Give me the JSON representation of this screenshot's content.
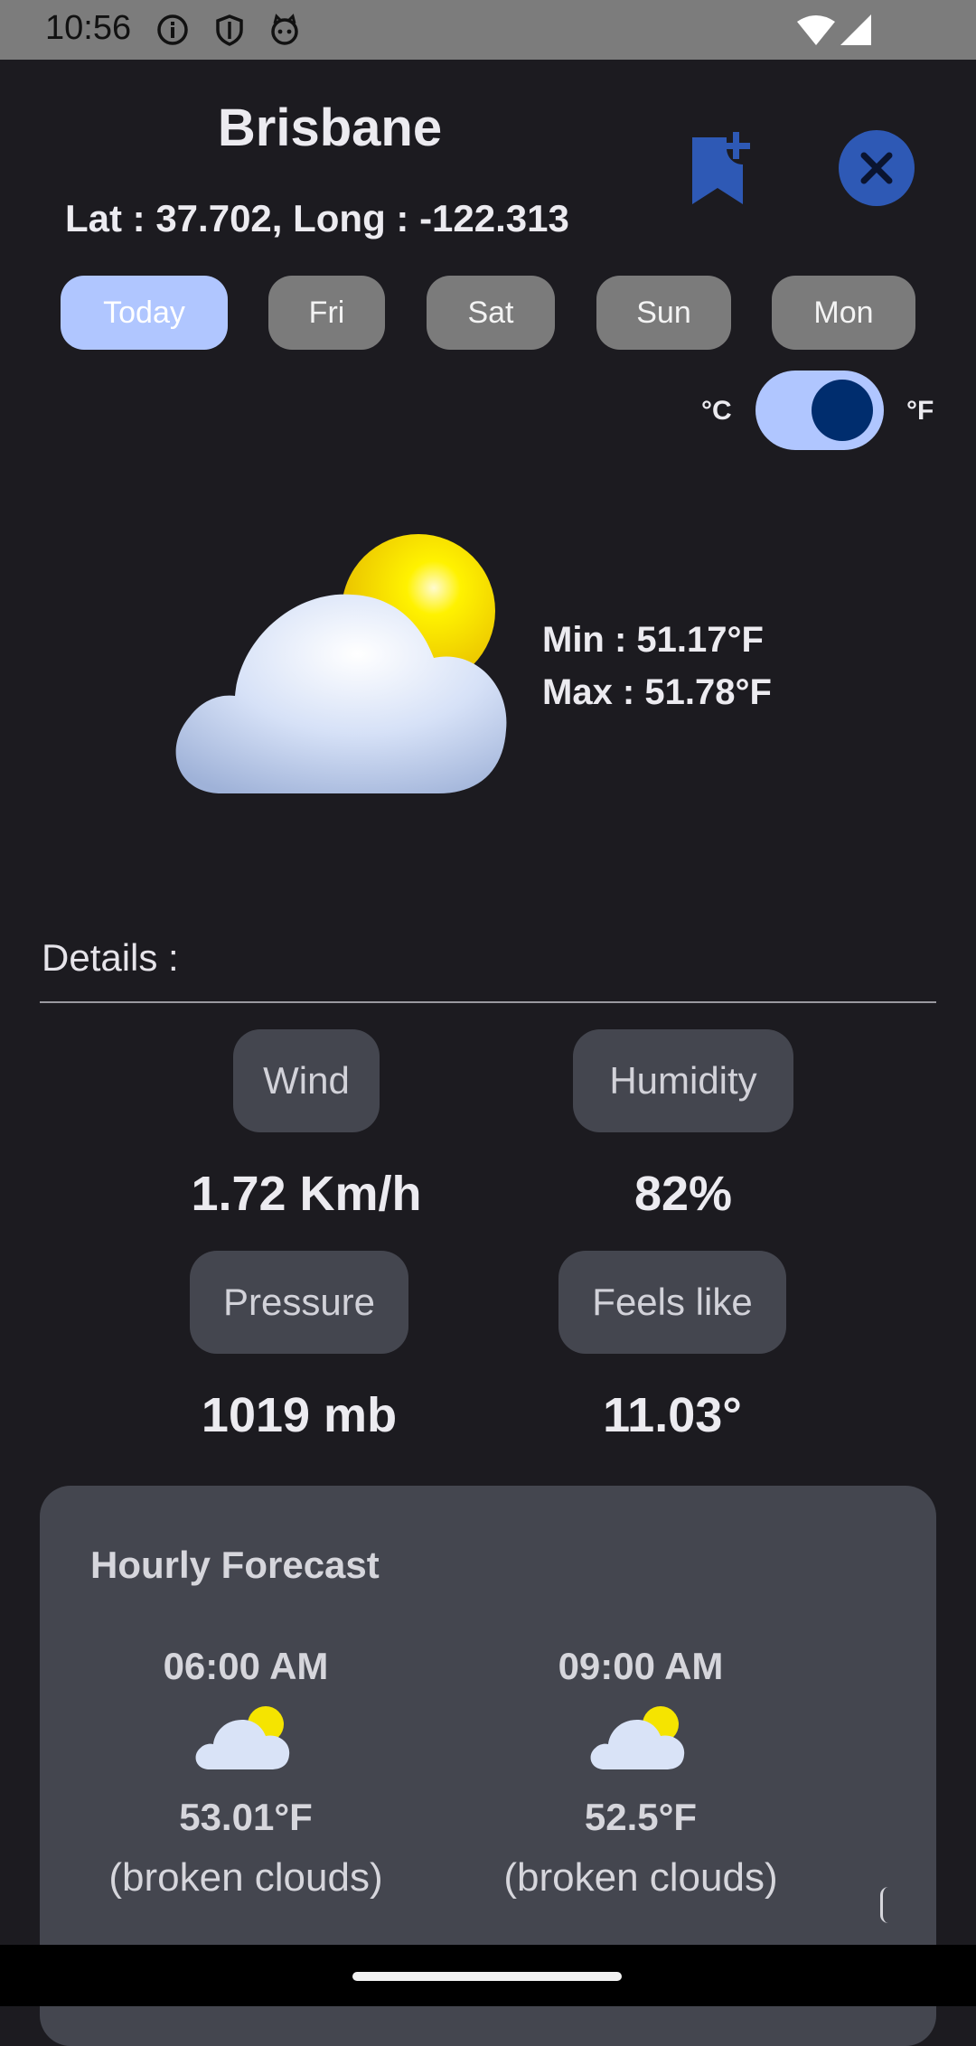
{
  "status_bar": {
    "time": "10:56",
    "icons": [
      "info-icon",
      "shield-icon",
      "cat-face-icon",
      "wifi-icon",
      "signal-icon"
    ]
  },
  "header": {
    "city": "Brisbane",
    "coords": "Lat : 37.702, Long : -122.313",
    "bookmark_icon": "bookmark-add-icon",
    "close_icon": "close-icon"
  },
  "days": {
    "today": "Today",
    "fri": "Fri",
    "sat": "Sat",
    "sun": "Sun",
    "mon": "Mon"
  },
  "units": {
    "celsius": "°C",
    "fahrenheit": "°F",
    "selected": "°F"
  },
  "current": {
    "icon": "partly-cloudy-icon",
    "min": "Min : 51.17°F",
    "max": "Max : 51.78°F"
  },
  "details": {
    "label": "Details :",
    "wind_label": "Wind",
    "wind_value": "1.72 Km/h",
    "humidity_label": "Humidity",
    "humidity_value": "82%",
    "pressure_label": "Pressure",
    "pressure_value": "1019 mb",
    "feels_label": "Feels like",
    "feels_value": "11.03°"
  },
  "hourly": {
    "title": "Hourly Forecast",
    "items": [
      {
        "time": "06:00 AM",
        "temp": "53.01°F",
        "desc": "(broken clouds)",
        "icon": "partly-cloudy-icon"
      },
      {
        "time": "09:00 AM",
        "temp": "52.5°F",
        "desc": "(broken clouds)",
        "icon": "partly-cloudy-icon"
      }
    ]
  },
  "colors": {
    "background": "#1c1b20",
    "accent": "#b0c6ff",
    "accent_dark": "#002d6e",
    "close_button": "#2e59b5",
    "card": "#44464f",
    "chip_inactive": "#7b7b7b"
  }
}
